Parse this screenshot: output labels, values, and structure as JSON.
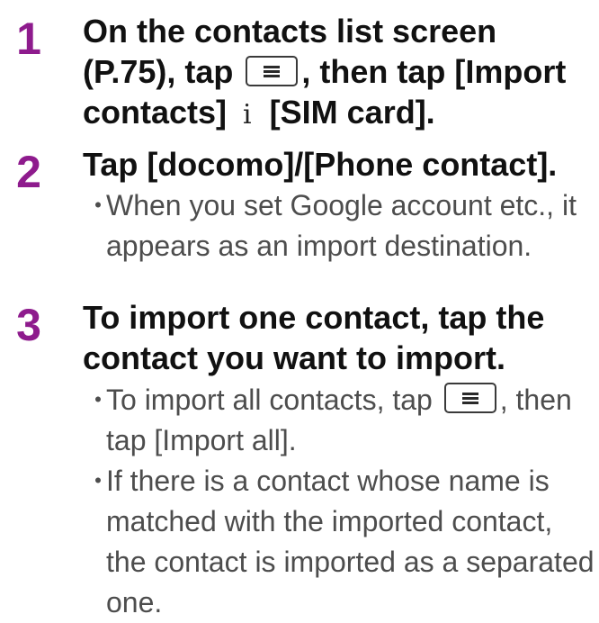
{
  "steps": [
    {
      "number": "1",
      "title_part1": "On the contacts list screen (P.75), tap",
      "title_part2": ", then tap [Import contacts]",
      "arrow": "i",
      "title_part3": "[SIM card].",
      "menu_key_icon": "menu-key-icon"
    },
    {
      "number": "2",
      "title": "Tap [docomo]/[Phone contact].",
      "bullets": [
        {
          "dot": "・",
          "text": "When you set Google account etc., it appears as an import destination."
        }
      ]
    },
    {
      "number": "3",
      "title": "To import one contact, tap the contact you want to import.",
      "bullets": [
        {
          "dot": "・",
          "text_before_key": "To import all contacts, tap",
          "text_after_key": ", then tap [Import all].",
          "key_icon": "menu-key-icon"
        },
        {
          "dot": "・",
          "text": "If there is a contact whose name is matched with the imported contact, the contact is imported as a separated one."
        }
      ]
    }
  ],
  "colors": {
    "step_number": "#8e1b8d",
    "title": "#111111",
    "bullet_text": "#4d4d4d"
  }
}
